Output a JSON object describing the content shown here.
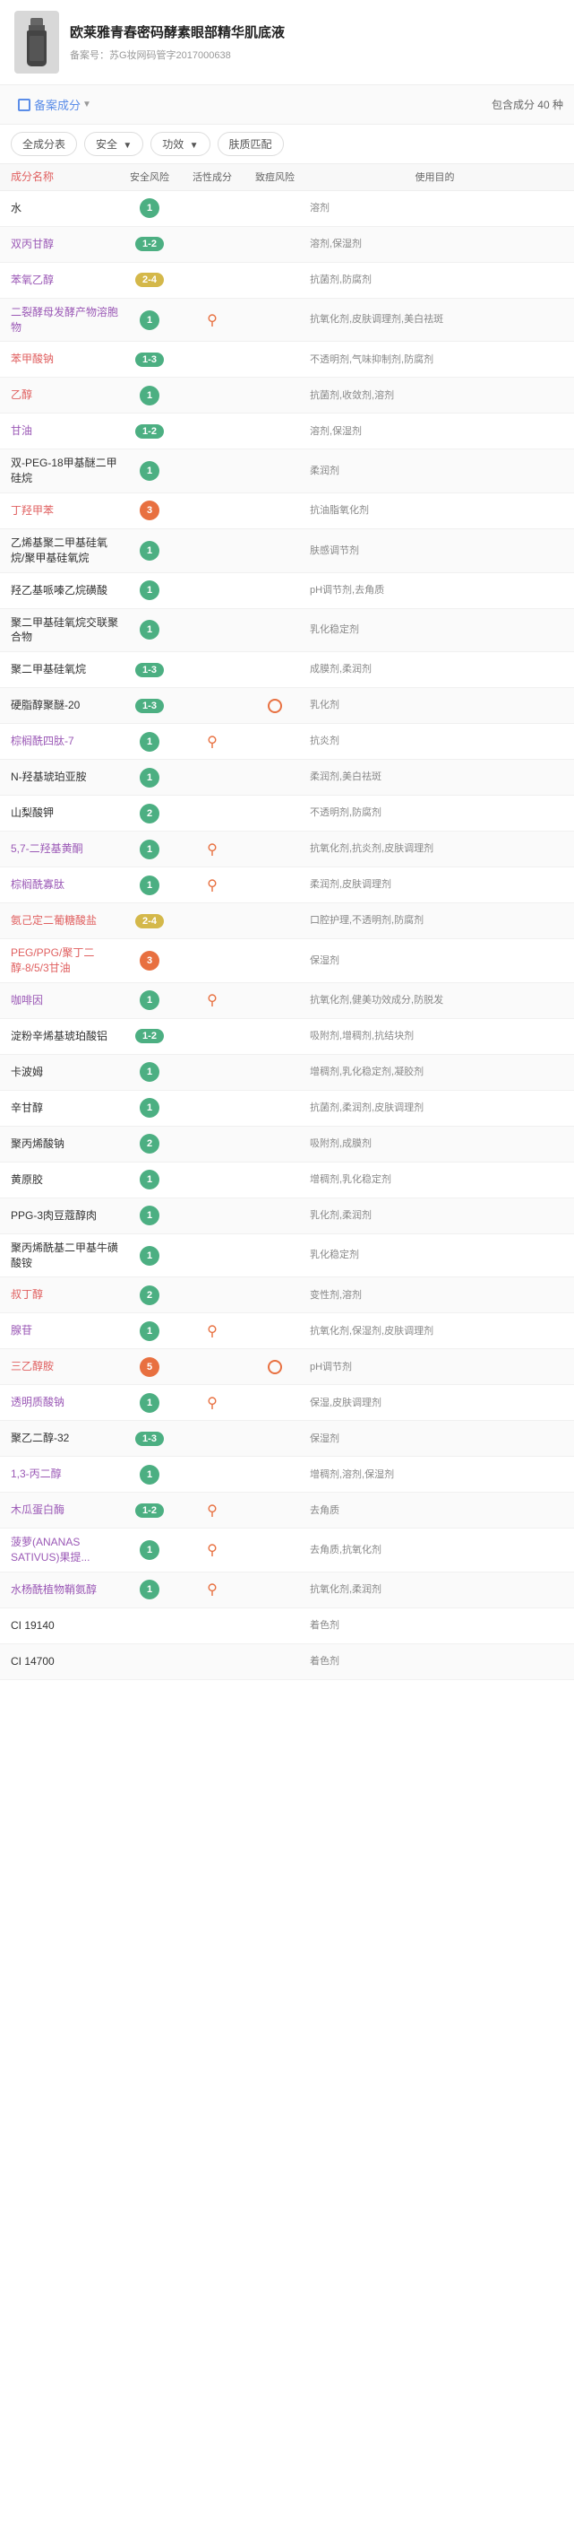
{
  "header": {
    "title": "欧莱雅青春密码酵素眼部精华肌底液",
    "subtitle": "备案号：苏G妆网码管字2017000638"
  },
  "tabs": {
    "active": "备案成分",
    "count_label": "包含成分 40 种"
  },
  "filters": {
    "all": "全成分表",
    "safety": "安全",
    "effect": "功效",
    "skin": "肤质匹配"
  },
  "table_header": {
    "name": "成分名称",
    "safety": "安全风险",
    "active": "活性成分",
    "acne": "致痘风险",
    "purpose": "使用目的"
  },
  "rows": [
    {
      "name": "水",
      "name_color": "black",
      "safety": "1",
      "safety_color": "green",
      "safety_type": "badge",
      "active": "",
      "acne": "",
      "purpose": "溶剂"
    },
    {
      "name": "双丙甘醇",
      "name_color": "purple",
      "safety": "1-2",
      "safety_color": "green",
      "safety_type": "range",
      "active": "",
      "acne": "",
      "purpose": "溶剂,保湿剂"
    },
    {
      "name": "苯氧乙醇",
      "name_color": "purple",
      "safety": "2-4",
      "safety_color": "yellow",
      "safety_type": "range",
      "active": "",
      "acne": "",
      "purpose": "抗菌剂,防腐剂"
    },
    {
      "name": "二裂酵母发酵产物溶胞物",
      "name_color": "purple",
      "safety": "1",
      "safety_color": "green",
      "safety_type": "badge",
      "active": "♂",
      "acne": "",
      "purpose": "抗氧化剂,皮肤调理剂,美白祛斑"
    },
    {
      "name": "苯甲酸钠",
      "name_color": "red",
      "safety": "1-3",
      "safety_color": "green",
      "safety_type": "range",
      "active": "",
      "acne": "",
      "purpose": "不透明剂,气味抑制剂,防腐剂"
    },
    {
      "name": "乙醇",
      "name_color": "red",
      "safety": "1",
      "safety_color": "green",
      "safety_type": "badge",
      "active": "",
      "acne": "",
      "purpose": "抗菌剂,收敛剂,溶剂"
    },
    {
      "name": "甘油",
      "name_color": "purple",
      "safety": "1-2",
      "safety_color": "green",
      "safety_type": "range",
      "active": "",
      "acne": "",
      "purpose": "溶剂,保湿剂"
    },
    {
      "name": "双-PEG-18甲基醚二甲硅烷",
      "name_color": "black",
      "safety": "1",
      "safety_color": "green",
      "safety_type": "badge",
      "active": "",
      "acne": "",
      "purpose": "柔润剂"
    },
    {
      "name": "丁羟甲苯",
      "name_color": "red",
      "safety": "3",
      "safety_color": "orange",
      "safety_type": "badge",
      "active": "",
      "acne": "",
      "purpose": "抗油脂氧化剂"
    },
    {
      "name": "乙烯基聚二甲基硅氧烷/聚甲基硅氧烷",
      "name_color": "black",
      "safety": "1",
      "safety_color": "green",
      "safety_type": "badge",
      "active": "",
      "acne": "",
      "purpose": "肤感调节剂"
    },
    {
      "name": "羟乙基哌嗪乙烷磺酸",
      "name_color": "black",
      "safety": "1",
      "safety_color": "green",
      "safety_type": "badge",
      "active": "",
      "acne": "",
      "purpose": "pH调节剂,去角质"
    },
    {
      "name": "聚二甲基硅氧烷交联聚合物",
      "name_color": "black",
      "safety": "1",
      "safety_color": "green",
      "safety_type": "badge",
      "active": "",
      "acne": "",
      "purpose": "乳化稳定剂"
    },
    {
      "name": "聚二甲基硅氧烷",
      "name_color": "black",
      "safety": "1-3",
      "safety_color": "green",
      "safety_type": "range",
      "active": "",
      "acne": "",
      "purpose": "成膜剂,柔润剂"
    },
    {
      "name": "硬脂醇聚醚-20",
      "name_color": "black",
      "safety": "1-3",
      "safety_color": "green",
      "safety_type": "range",
      "active": "",
      "acne": "○",
      "purpose": "乳化剂"
    },
    {
      "name": "棕榈酰四肽-7",
      "name_color": "purple",
      "safety": "1",
      "safety_color": "green",
      "safety_type": "badge",
      "active": "♂",
      "acne": "",
      "purpose": "抗炎剂"
    },
    {
      "name": "N-羟基琥珀亚胺",
      "name_color": "black",
      "safety": "1",
      "safety_color": "green",
      "safety_type": "badge",
      "active": "",
      "acne": "",
      "purpose": "柔润剂,美白祛斑"
    },
    {
      "name": "山梨酸钾",
      "name_color": "black",
      "safety": "2",
      "safety_color": "green",
      "safety_type": "badge",
      "active": "",
      "acne": "",
      "purpose": "不透明剂,防腐剂"
    },
    {
      "name": "5,7-二羟基黄酮",
      "name_color": "purple",
      "safety": "1",
      "safety_color": "green",
      "safety_type": "badge",
      "active": "♂",
      "acne": "",
      "purpose": "抗氧化剂,抗炎剂,皮肤调理剂"
    },
    {
      "name": "棕榈酰寡肽",
      "name_color": "purple",
      "safety": "1",
      "safety_color": "green",
      "safety_type": "badge",
      "active": "♂",
      "acne": "",
      "purpose": "柔润剂,皮肤调理剂"
    },
    {
      "name": "氨己定二葡糖酸盐",
      "name_color": "red",
      "safety": "2-4",
      "safety_color": "yellow",
      "safety_type": "range",
      "active": "",
      "acne": "",
      "purpose": "口腔护理,不透明剂,防腐剂"
    },
    {
      "name": "PEG/PPG/聚丁二醇-8/5/3甘油",
      "name_color": "red",
      "safety": "3",
      "safety_color": "orange",
      "safety_type": "badge",
      "active": "",
      "acne": "",
      "purpose": "保湿剂"
    },
    {
      "name": "咖啡因",
      "name_color": "purple",
      "safety": "1",
      "safety_color": "green",
      "safety_type": "badge",
      "active": "♂",
      "acne": "",
      "purpose": "抗氧化剂,健美功效成分,防脱发"
    },
    {
      "name": "淀粉辛烯基琥珀酸铝",
      "name_color": "black",
      "safety": "1-2",
      "safety_color": "green",
      "safety_type": "range",
      "active": "",
      "acne": "",
      "purpose": "吸附剂,增稠剂,抗结块剂"
    },
    {
      "name": "卡波姆",
      "name_color": "black",
      "safety": "1",
      "safety_color": "green",
      "safety_type": "badge",
      "active": "",
      "acne": "",
      "purpose": "增稠剂,乳化稳定剂,凝胶剂"
    },
    {
      "name": "辛甘醇",
      "name_color": "black",
      "safety": "1",
      "safety_color": "green",
      "safety_type": "badge",
      "active": "",
      "acne": "",
      "purpose": "抗菌剂,柔润剂,皮肤调理剂"
    },
    {
      "name": "聚丙烯酸钠",
      "name_color": "black",
      "safety": "2",
      "safety_color": "green",
      "safety_type": "badge",
      "active": "",
      "acne": "",
      "purpose": "吸附剂,成膜剂"
    },
    {
      "name": "黄原胶",
      "name_color": "black",
      "safety": "1",
      "safety_color": "green",
      "safety_type": "badge",
      "active": "",
      "acne": "",
      "purpose": "增稠剂,乳化稳定剂"
    },
    {
      "name": "PPG-3肉豆蔻醇肉",
      "name_color": "black",
      "safety": "1",
      "safety_color": "green",
      "safety_type": "badge",
      "active": "",
      "acne": "",
      "purpose": "乳化剂,柔润剂"
    },
    {
      "name": "聚丙烯酰基二甲基牛磺酸铵",
      "name_color": "black",
      "safety": "1",
      "safety_color": "green",
      "safety_type": "badge",
      "active": "",
      "acne": "",
      "purpose": "乳化稳定剂"
    },
    {
      "name": "叔丁醇",
      "name_color": "red",
      "safety": "2",
      "safety_color": "green",
      "safety_type": "badge",
      "active": "",
      "acne": "",
      "purpose": "变性剂,溶剂"
    },
    {
      "name": "腺苷",
      "name_color": "purple",
      "safety": "1",
      "safety_color": "green",
      "safety_type": "badge",
      "active": "♂",
      "acne": "",
      "purpose": "抗氧化剂,保湿剂,皮肤调理剂"
    },
    {
      "name": "三乙醇胺",
      "name_color": "red",
      "safety": "5",
      "safety_color": "orange",
      "safety_type": "badge",
      "active": "",
      "acne": "○",
      "purpose": "pH调节剂"
    },
    {
      "name": "透明质酸钠",
      "name_color": "purple",
      "safety": "1",
      "safety_color": "green",
      "safety_type": "badge",
      "active": "♂",
      "acne": "",
      "purpose": "保湿,皮肤调理剂"
    },
    {
      "name": "聚乙二醇-32",
      "name_color": "black",
      "safety": "1-3",
      "safety_color": "green",
      "safety_type": "range",
      "active": "",
      "acne": "",
      "purpose": "保湿剂"
    },
    {
      "name": "1,3-丙二醇",
      "name_color": "purple",
      "safety": "1",
      "safety_color": "green",
      "safety_type": "badge",
      "active": "",
      "acne": "",
      "purpose": "增稠剂,溶剂,保湿剂"
    },
    {
      "name": "木瓜蛋白酶",
      "name_color": "purple",
      "safety": "1-2",
      "safety_color": "green",
      "safety_type": "range",
      "active": "♂",
      "acne": "",
      "purpose": "去角质"
    },
    {
      "name": "菠萝(ANANAS SATIVUS)果提...",
      "name_color": "purple",
      "safety": "1",
      "safety_color": "green",
      "safety_type": "badge",
      "active": "♂",
      "acne": "",
      "purpose": "去角质,抗氧化剂"
    },
    {
      "name": "水杨酰植物鞘氨醇",
      "name_color": "purple",
      "safety": "1",
      "safety_color": "green",
      "safety_type": "badge",
      "active": "♂",
      "acne": "",
      "purpose": "抗氧化剂,柔润剂"
    },
    {
      "name": "CI 19140",
      "name_color": "black",
      "safety": "",
      "safety_color": "",
      "safety_type": "none",
      "active": "",
      "acne": "",
      "purpose": "着色剂"
    },
    {
      "name": "CI 14700",
      "name_color": "black",
      "safety": "",
      "safety_color": "",
      "safety_type": "none",
      "active": "",
      "acne": "",
      "purpose": "着色剂"
    }
  ]
}
